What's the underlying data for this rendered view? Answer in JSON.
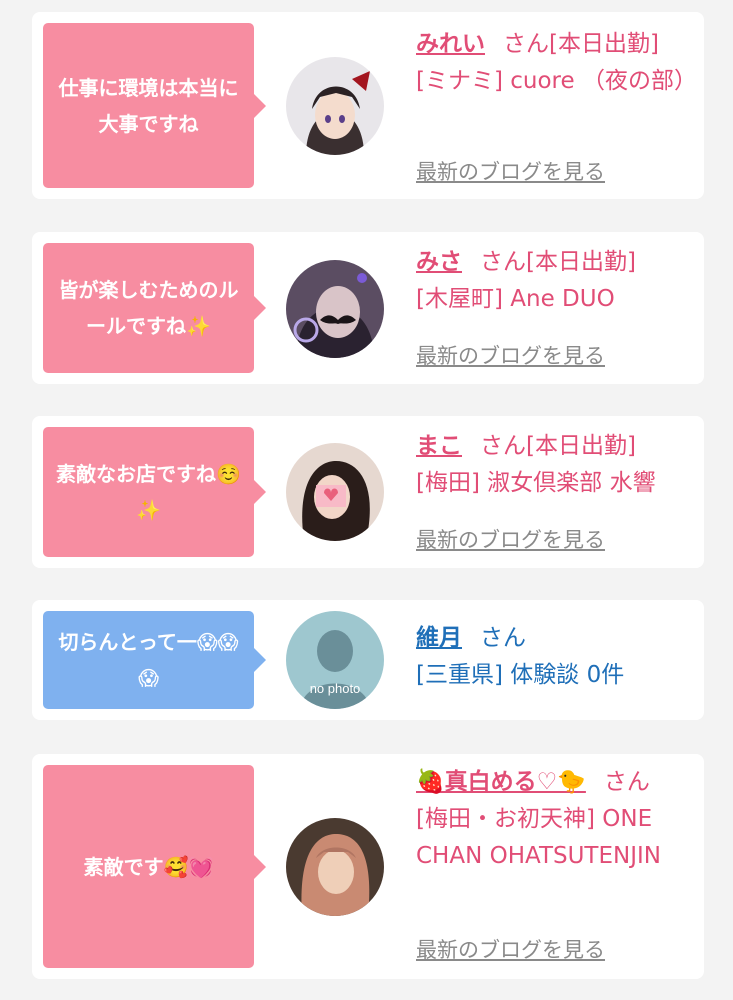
{
  "comments": [
    {
      "bubble_text": "仕事に環境は本当に大事ですね",
      "bubble_color": "#f78da1",
      "name": "みれい",
      "san": "さん",
      "status": "[本日出勤]",
      "location": "[ミナミ] cuore （夜の部）",
      "blog_link": "最新のブログを見る"
    },
    {
      "bubble_text": "皆が楽しむためのルールですね✨",
      "bubble_color": "#f78da1",
      "name": "みさ",
      "san": "さん",
      "status": "[本日出勤]",
      "location": "[木屋町] Ane DUO",
      "blog_link": "最新のブログを見る"
    },
    {
      "bubble_text": "素敵なお店ですね☺️✨",
      "bubble_color": "#f78da1",
      "name": "まこ",
      "san": "さん",
      "status": "[本日出勤]",
      "location": "[梅田] 淑女倶楽部 水響",
      "blog_link": "最新のブログを見る"
    },
    {
      "bubble_text": "切らんとって一😱😱😱",
      "bubble_color": "#7fb1ef",
      "name": "維月",
      "san": "さん",
      "location": "[三重県] 体験談 0件",
      "avatar_text": "no photo"
    },
    {
      "bubble_text": "素敵です🥰💓",
      "bubble_color": "#f78da1",
      "name": "🍓真白める♡🐤",
      "san": "さん",
      "location": "[梅田・お初天神] ONE CHAN OHATSUTENJIN",
      "blog_link": "最新のブログを見る"
    }
  ],
  "colors": {
    "accent_pink": "#e14d76",
    "accent_blue": "#1f6fb8",
    "link_gray": "#8a8a8a"
  }
}
